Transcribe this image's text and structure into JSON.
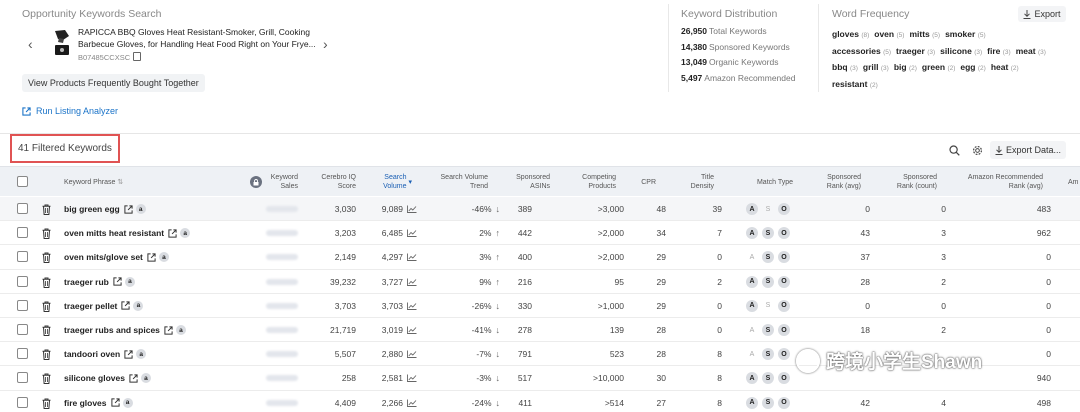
{
  "opportunity": {
    "title": "Opportunity Keywords Search",
    "product_title": "RAPICCA BBQ Gloves Heat Resistant-Smoker, Grill, Cooking Barbecue Gloves, for Handling Heat Food Right on Your Frye...",
    "asin": "B07485CCXSC",
    "fbt_button": "View Products Frequently Bought Together",
    "run_listing": "Run Listing Analyzer"
  },
  "keyword_distribution": {
    "title": "Keyword Distribution",
    "rows": [
      {
        "value": "26,950",
        "label": "Total Keywords"
      },
      {
        "value": "14,380",
        "label": "Sponsored Keywords"
      },
      {
        "value": "13,049",
        "label": "Organic Keywords"
      },
      {
        "value": "5,497",
        "label": "Amazon Recommended"
      }
    ]
  },
  "word_frequency": {
    "title": "Word Frequency",
    "export_label": "Export",
    "words": [
      {
        "w": "gloves",
        "n": "(8)"
      },
      {
        "w": "oven",
        "n": "(5)"
      },
      {
        "w": "mitts",
        "n": "(5)"
      },
      {
        "w": "smoker",
        "n": "(5)"
      },
      {
        "w": "accessories",
        "n": "(5)"
      },
      {
        "w": "traeger",
        "n": "(3)"
      },
      {
        "w": "silicone",
        "n": "(3)"
      },
      {
        "w": "fire",
        "n": "(3)"
      },
      {
        "w": "meat",
        "n": "(3)"
      },
      {
        "w": "bbq",
        "n": "(3)"
      },
      {
        "w": "grill",
        "n": "(3)"
      },
      {
        "w": "big",
        "n": "(2)"
      },
      {
        "w": "green",
        "n": "(2)"
      },
      {
        "w": "egg",
        "n": "(2)"
      },
      {
        "w": "heat",
        "n": "(2)"
      },
      {
        "w": "resistant",
        "n": "(2)"
      }
    ]
  },
  "filter": {
    "count_label": "41 Filtered Keywords",
    "export_data": "Export Data..."
  },
  "table": {
    "headers": {
      "phrase": "Keyword Phrase",
      "sales": "Keyword Sales",
      "cerebro": "Cerebro IQ Score",
      "search_volume": "Search Volume",
      "trend": "Search Volume Trend",
      "sponsored_asins": "Sponsored ASINs",
      "competing": "Competing Products",
      "cpr": "CPR",
      "title_density": "Title Density",
      "match_type": "Match Type",
      "sp_rank_avg": "Sponsored Rank (avg)",
      "sp_rank_count": "Sponsored Rank (count)",
      "amz_rec_rank": "Amazon Recommended Rank (avg)",
      "cut": "Am"
    },
    "rows": [
      {
        "kw": "big green egg",
        "iq": "3,030",
        "sv": "9,089",
        "trend": "-46%",
        "dir": "↓",
        "asins": "389",
        "comp": ">3,000",
        "cpr": "48",
        "td": "39",
        "mt": [
          true,
          false,
          true
        ],
        "spa": "0",
        "spc": "0",
        "amz": "483"
      },
      {
        "kw": "oven mitts heat resistant",
        "iq": "3,203",
        "sv": "6,485",
        "trend": "2%",
        "dir": "↑",
        "asins": "442",
        "comp": ">2,000",
        "cpr": "34",
        "td": "7",
        "mt": [
          true,
          true,
          true
        ],
        "spa": "43",
        "spc": "3",
        "amz": "962"
      },
      {
        "kw": "oven mits/glove set",
        "iq": "2,149",
        "sv": "4,297",
        "trend": "3%",
        "dir": "↑",
        "asins": "400",
        "comp": ">2,000",
        "cpr": "29",
        "td": "0",
        "mt": [
          false,
          true,
          true
        ],
        "spa": "37",
        "spc": "3",
        "amz": "0"
      },
      {
        "kw": "traeger rub",
        "iq": "39,232",
        "sv": "3,727",
        "trend": "9%",
        "dir": "↑",
        "asins": "216",
        "comp": "95",
        "cpr": "29",
        "td": "2",
        "mt": [
          true,
          true,
          true
        ],
        "spa": "28",
        "spc": "2",
        "amz": "0"
      },
      {
        "kw": "traeger pellet",
        "iq": "3,703",
        "sv": "3,703",
        "trend": "-26%",
        "dir": "↓",
        "asins": "330",
        "comp": ">1,000",
        "cpr": "29",
        "td": "0",
        "mt": [
          true,
          false,
          true
        ],
        "spa": "0",
        "spc": "0",
        "amz": "0"
      },
      {
        "kw": "traeger rubs and spices",
        "iq": "21,719",
        "sv": "3,019",
        "trend": "-41%",
        "dir": "↓",
        "asins": "278",
        "comp": "139",
        "cpr": "28",
        "td": "0",
        "mt": [
          false,
          true,
          true
        ],
        "spa": "18",
        "spc": "2",
        "amz": "0"
      },
      {
        "kw": "tandoori oven",
        "iq": "5,507",
        "sv": "2,880",
        "trend": "-7%",
        "dir": "↓",
        "asins": "791",
        "comp": "523",
        "cpr": "28",
        "td": "8",
        "mt": [
          false,
          true,
          true
        ],
        "spa": "",
        "spc": "",
        "amz": "0"
      },
      {
        "kw": "silicone gloves",
        "iq": "258",
        "sv": "2,581",
        "trend": "-3%",
        "dir": "↓",
        "asins": "517",
        "comp": ">10,000",
        "cpr": "30",
        "td": "8",
        "mt": [
          true,
          true,
          true
        ],
        "spa": "",
        "spc": "",
        "amz": "940"
      },
      {
        "kw": "fire gloves",
        "iq": "4,409",
        "sv": "2,266",
        "trend": "-24%",
        "dir": "↓",
        "asins": "411",
        "comp": ">514",
        "cpr": "27",
        "td": "8",
        "mt": [
          true,
          true,
          true
        ],
        "spa": "42",
        "spc": "4",
        "amz": "498"
      }
    ]
  },
  "watermark": "跨境小学生Shawn"
}
